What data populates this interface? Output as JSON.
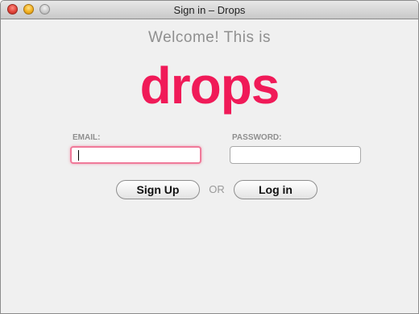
{
  "window": {
    "title": "Sign in – Drops"
  },
  "header": {
    "welcome_text": "Welcome! This is",
    "logo_text": "drops"
  },
  "form": {
    "email_label": "EMAIL:",
    "email_value": "",
    "password_label": "PASSWORD:",
    "password_value": ""
  },
  "actions": {
    "signup_label": "Sign Up",
    "or_text": "OR",
    "login_label": "Log in"
  },
  "colors": {
    "brand": "#f01a58",
    "focus_ring": "#f07a9a"
  }
}
